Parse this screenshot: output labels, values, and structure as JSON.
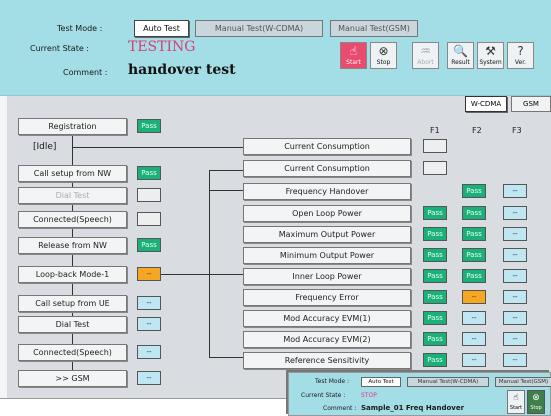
{
  "header": {
    "mode_label": "Test Mode :",
    "modes": [
      "Auto Test",
      "Manual Test(W-CDMA)",
      "Manual Test(GSM)"
    ],
    "current_state_label": "Current State :",
    "current_state_value": "TESTING",
    "comment_label": "Comment :",
    "comment_value": "handover test"
  },
  "toolbar": [
    {
      "label": "Start",
      "icon": "hand-pointer-icon",
      "glyph": "☝"
    },
    {
      "label": "Stop",
      "icon": "stop-icon",
      "glyph": "⊗"
    },
    {
      "label": "Abort",
      "icon": "abort-icon",
      "glyph": "♒"
    },
    {
      "label": "Result",
      "icon": "result-icon",
      "glyph": "🔍"
    },
    {
      "label": "System",
      "icon": "system-icon",
      "glyph": "⚒"
    },
    {
      "label": "Ver.",
      "icon": "help-icon",
      "glyph": "?"
    }
  ],
  "tabs": [
    "W-CDMA",
    "GSM"
  ],
  "columns": [
    "F1",
    "F2",
    "F3"
  ],
  "left_steps": [
    {
      "label": "Registration",
      "badge": "Pass",
      "state": "pass"
    },
    {
      "label": "[Idle]"
    },
    {
      "label": "Call setup from NW",
      "badge": "Pass",
      "state": "pass"
    },
    {
      "label": "Dial Test",
      "badge": "",
      "state": "gray"
    },
    {
      "label": "Connected(Speech)",
      "badge": "",
      "state": "gray"
    },
    {
      "label": "Release from NW",
      "badge": "Pass",
      "state": "pass"
    },
    {
      "label": "Loop-back Mode-1",
      "badge": "--",
      "state": "orange"
    },
    {
      "label": "Call setup from UE",
      "badge": "--",
      "state": "dash"
    },
    {
      "label": "Dial Test",
      "badge": "--",
      "state": "dash"
    },
    {
      "label": "Connected(Speech)",
      "badge": "--",
      "state": "dash"
    },
    {
      "label": ">> GSM",
      "badge": "--",
      "state": "dash"
    }
  ],
  "measurements": [
    {
      "label": "Current Consumption",
      "cells": [
        [
          "",
          "gray"
        ],
        null,
        null
      ]
    },
    {
      "label": "Current Consumption",
      "cells": [
        [
          "",
          "gray"
        ],
        null,
        null
      ]
    },
    {
      "label": "Frequency Handover",
      "cells": [
        null,
        [
          "Pass",
          "pass"
        ],
        [
          "--",
          "dash"
        ]
      ]
    },
    {
      "label": "Open Loop Power",
      "cells": [
        [
          "Pass",
          "pass"
        ],
        [
          "Pass",
          "pass"
        ],
        [
          "--",
          "dash"
        ]
      ]
    },
    {
      "label": "Maximum Output Power",
      "cells": [
        [
          "Pass",
          "pass"
        ],
        [
          "Pass",
          "pass"
        ],
        [
          "--",
          "dash"
        ]
      ]
    },
    {
      "label": "Minimum Output Power",
      "cells": [
        [
          "Pass",
          "pass"
        ],
        [
          "Pass",
          "pass"
        ],
        [
          "--",
          "dash"
        ]
      ]
    },
    {
      "label": "Inner Loop Power",
      "cells": [
        [
          "Pass",
          "pass"
        ],
        [
          "Pass",
          "pass"
        ],
        [
          "--",
          "dash"
        ]
      ]
    },
    {
      "label": "Frequency Error",
      "cells": [
        [
          "Pass",
          "pass"
        ],
        [
          "--",
          "orange"
        ],
        [
          "--",
          "dash"
        ]
      ]
    },
    {
      "label": "Mod Accuracy EVM(1)",
      "cells": [
        [
          "Pass",
          "pass"
        ],
        [
          "--",
          "dash"
        ],
        [
          "--",
          "dash"
        ]
      ]
    },
    {
      "label": "Mod Accuracy EVM(2)",
      "cells": [
        [
          "Pass",
          "pass"
        ],
        [
          "--",
          "dash"
        ],
        [
          "--",
          "dash"
        ]
      ]
    },
    {
      "label": "Reference Sensitivity",
      "cells": [
        [
          "Pass",
          "pass"
        ],
        [
          "--",
          "dash"
        ],
        [
          "--",
          "dash"
        ]
      ]
    }
  ],
  "inset": {
    "mode_label": "Test Mode :",
    "modes": [
      "Auto Test",
      "Manual Test(W-CDMA)",
      "Manual Test(GSM)"
    ],
    "state_label": "Current State :",
    "state_value": "STOP",
    "comment_label": "Comment :",
    "comment_value": "Sample_01 Freq Handover",
    "buttons": [
      "Start",
      "Stop"
    ]
  }
}
